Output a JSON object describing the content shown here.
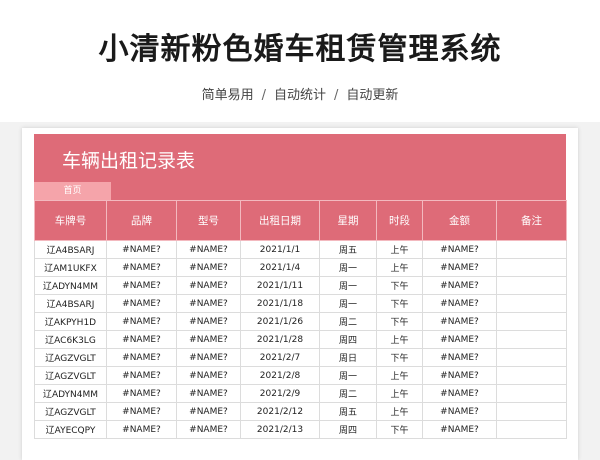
{
  "title": "小清新粉色婚车租赁管理系统",
  "subtitle": [
    "简单易用",
    "自动统计",
    "自动更新"
  ],
  "subtitle_sep": "/",
  "sheet": {
    "title": "车辆出租记录表",
    "tab_home": "首页",
    "columns": [
      "车牌号",
      "品牌",
      "型号",
      "出租日期",
      "星期",
      "时段",
      "金额",
      "备注"
    ],
    "rows": [
      [
        "辽A4BSARJ",
        "#NAME?",
        "#NAME?",
        "2021/1/1",
        "周五",
        "上午",
        "#NAME?",
        ""
      ],
      [
        "辽AM1UKFX",
        "#NAME?",
        "#NAME?",
        "2021/1/4",
        "周一",
        "上午",
        "#NAME?",
        ""
      ],
      [
        "辽ADYN4MM",
        "#NAME?",
        "#NAME?",
        "2021/1/11",
        "周一",
        "下午",
        "#NAME?",
        ""
      ],
      [
        "辽A4BSARJ",
        "#NAME?",
        "#NAME?",
        "2021/1/18",
        "周一",
        "下午",
        "#NAME?",
        ""
      ],
      [
        "辽AKPYH1D",
        "#NAME?",
        "#NAME?",
        "2021/1/26",
        "周二",
        "下午",
        "#NAME?",
        ""
      ],
      [
        "辽AC6K3LG",
        "#NAME?",
        "#NAME?",
        "2021/1/28",
        "周四",
        "上午",
        "#NAME?",
        ""
      ],
      [
        "辽AGZVGLT",
        "#NAME?",
        "#NAME?",
        "2021/2/7",
        "周日",
        "下午",
        "#NAME?",
        ""
      ],
      [
        "辽AGZVGLT",
        "#NAME?",
        "#NAME?",
        "2021/2/8",
        "周一",
        "上午",
        "#NAME?",
        ""
      ],
      [
        "辽ADYN4MM",
        "#NAME?",
        "#NAME?",
        "2021/2/9",
        "周二",
        "上午",
        "#NAME?",
        ""
      ],
      [
        "辽AGZVGLT",
        "#NAME?",
        "#NAME?",
        "2021/2/12",
        "周五",
        "上午",
        "#NAME?",
        ""
      ],
      [
        "辽AYECQPY",
        "#NAME?",
        "#NAME?",
        "2021/2/13",
        "周四",
        "下午",
        "#NAME?",
        ""
      ]
    ]
  }
}
